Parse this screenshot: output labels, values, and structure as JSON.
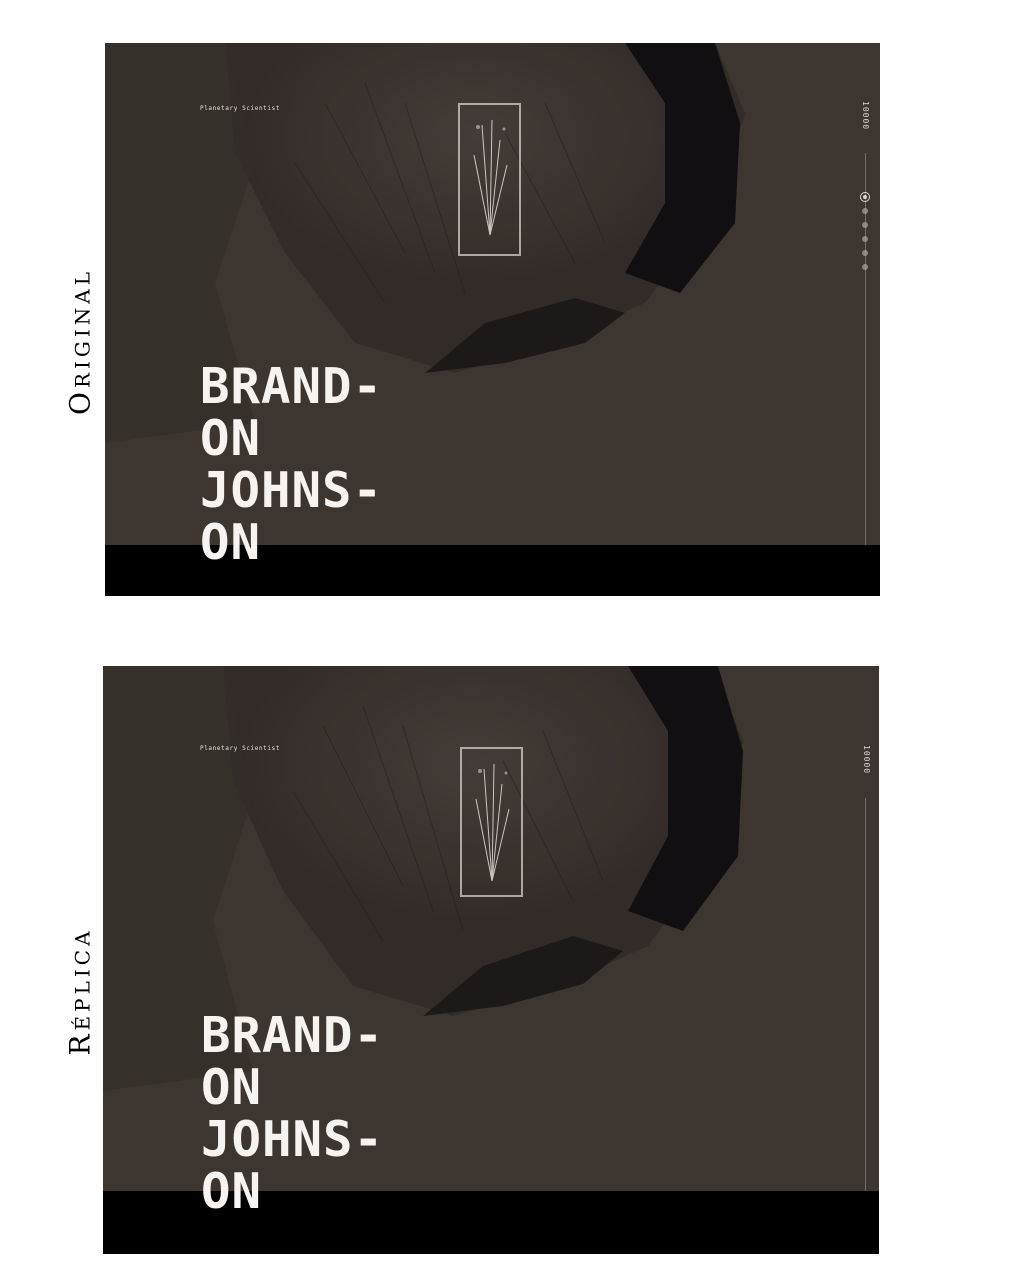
{
  "labels": {
    "original": "Original",
    "replica": "Réplica"
  },
  "original": {
    "role": "Planetary Scientist",
    "counter": "10000",
    "name_lines": [
      "BRAND-",
      "ON",
      "JOHNS-",
      "ON"
    ]
  },
  "replica": {
    "role": "Planetary Scientist",
    "counter": "10000",
    "name_lines": [
      "BRAND-",
      "ON",
      "JOHNS-",
      "ON"
    ]
  },
  "colors": {
    "terrain": "#3e3631",
    "bar": "#000000",
    "text": "#f6f3f0"
  }
}
